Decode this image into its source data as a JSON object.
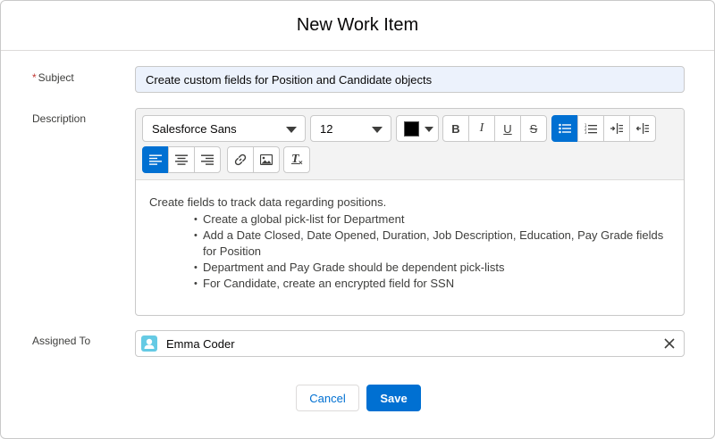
{
  "modal": {
    "title": "New Work Item"
  },
  "subject": {
    "required_marker": "*",
    "label": "Subject",
    "value": "Create custom fields for Position and Candidate objects"
  },
  "description": {
    "label": "Description",
    "toolbar": {
      "font_family": "Salesforce Sans",
      "font_size": "12",
      "text_color": "#000000",
      "bold_label": "B",
      "italic_label": "I",
      "underline_label": "U",
      "strikethrough_label": "S",
      "clear_format_label": "T",
      "icons": [
        "chevron-down-icon",
        "bold-icon",
        "italic-icon",
        "underline-icon",
        "strikethrough-icon",
        "bulleted-list-icon",
        "numbered-list-icon",
        "indent-icon",
        "outdent-icon",
        "align-left-icon",
        "align-center-icon",
        "align-right-icon",
        "link-icon",
        "image-icon",
        "remove-formatting-icon"
      ]
    },
    "intro": "Create fields to track data regarding positions.",
    "bullets": [
      "Create a global pick-list for Department",
      "Add a Date Closed, Date Opened, Duration, Job Description, Education, Pay Grade fields for Position",
      "Department and Pay Grade should be dependent pick-lists",
      "For Candidate, create an encrypted field for SSN"
    ]
  },
  "assigned_to": {
    "label": "Assigned To",
    "value": "Emma Coder",
    "icons": [
      "user-avatar-icon",
      "close-icon"
    ]
  },
  "footer": {
    "cancel_label": "Cancel",
    "save_label": "Save"
  },
  "colors": {
    "brand": "#0070d2",
    "subject_background": "#ecf2fc",
    "avatar": "#65cae4",
    "required": "#c23934"
  }
}
